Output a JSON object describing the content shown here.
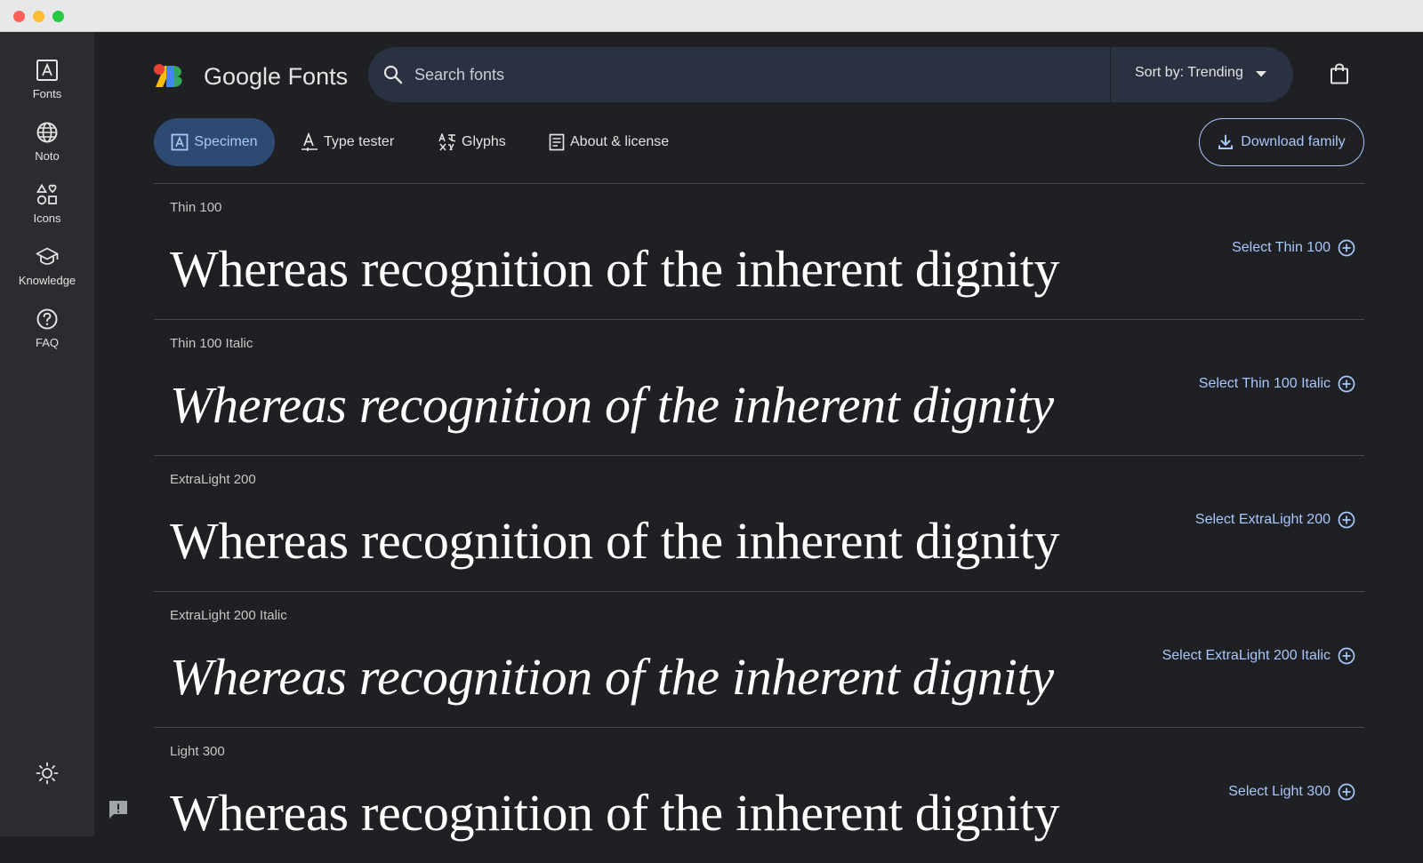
{
  "sidebar": {
    "items": [
      {
        "label": "Fonts"
      },
      {
        "label": "Noto"
      },
      {
        "label": "Icons"
      },
      {
        "label": "Knowledge"
      },
      {
        "label": "FAQ"
      }
    ]
  },
  "header": {
    "logo_text": "Google Fonts",
    "search_placeholder": "Search fonts",
    "sort_label": "Sort by: Trending"
  },
  "tabs": [
    {
      "label": "Specimen",
      "active": true
    },
    {
      "label": "Type tester"
    },
    {
      "label": "Glyphs"
    },
    {
      "label": "About & license"
    }
  ],
  "download_label": "Download family",
  "styles": [
    {
      "label": "Thin 100",
      "sample": "Whereas recognition of the inherent dignity",
      "select": "Select Thin 100"
    },
    {
      "label": "Thin 100 Italic",
      "sample": "Whereas recognition of the inherent dignity",
      "select": "Select Thin 100 Italic"
    },
    {
      "label": "ExtraLight 200",
      "sample": "Whereas recognition of the inherent dignity",
      "select": "Select ExtraLight 200"
    },
    {
      "label": "ExtraLight 200 Italic",
      "sample": "Whereas recognition of the inherent dignity",
      "select": "Select ExtraLight 200 Italic"
    },
    {
      "label": "Light 300",
      "sample": "Whereas recognition of the inherent dignity",
      "select": "Select Light 300"
    }
  ],
  "colors": {
    "accent": "#a8c7fa",
    "background": "#1f2023",
    "sidebar": "#2b2c2f"
  }
}
